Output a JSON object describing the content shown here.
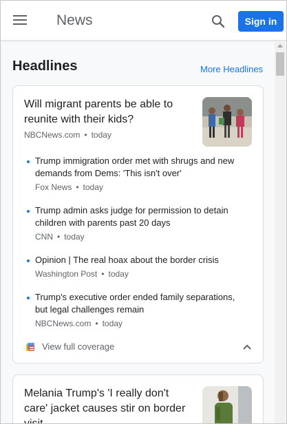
{
  "appbar": {
    "menu_icon": "hamburger-menu-icon",
    "brand": "News",
    "search_icon": "search-icon",
    "signin_label": "Sign in",
    "accent": "#1a73e8"
  },
  "headlines": {
    "title": "Headlines",
    "more_link": "More Headlines"
  },
  "cluster1": {
    "lead": {
      "title": "Will migrant parents be able to reunite with their kids?",
      "source": "NBCNews.com",
      "time": "today"
    },
    "stories": [
      {
        "title": "Trump immigration order met with shrugs and new demands from Dems: 'This isn't over'",
        "source": "Fox News",
        "time": "today"
      },
      {
        "title": "Trump admin asks judge for permission to detain children with parents past 20 days",
        "source": "CNN",
        "time": "today"
      },
      {
        "title": "Opinion | The real hoax about the border crisis",
        "source": "Washington Post",
        "time": "today"
      },
      {
        "title": "Trump's executive order ended family separations, but legal challenges remain",
        "source": "NBCNews.com",
        "time": "today"
      }
    ],
    "coverage_label": "View full coverage",
    "coverage_icon": "full-coverage-icon",
    "collapse_icon": "chevron-up-icon"
  },
  "cluster2": {
    "lead": {
      "title": "Melania Trump's 'I really don't care' jacket causes stir on border visit"
    }
  }
}
